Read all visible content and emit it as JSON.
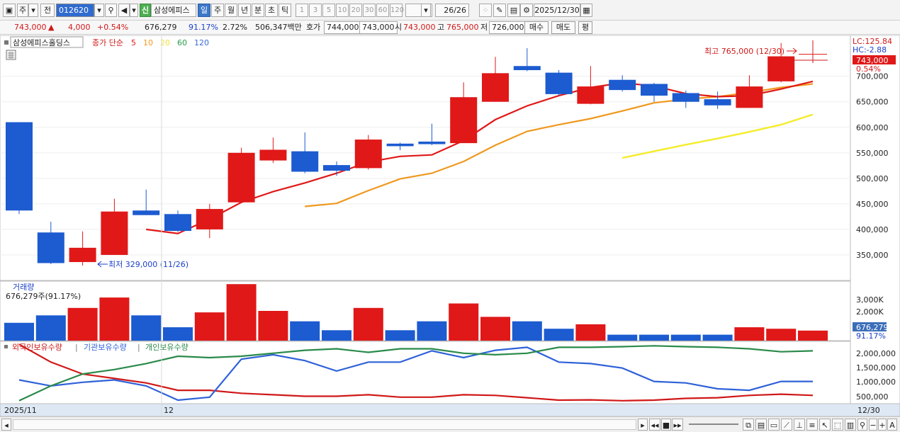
{
  "toolbar": {
    "period_label": "주",
    "prev_label": "전",
    "stock_code": "012620",
    "new_badge": "신",
    "stock_name": "삼성에피스",
    "periods": [
      "일",
      "주",
      "월",
      "년",
      "분",
      "초",
      "틱"
    ],
    "active_period": "일",
    "intervals": [
      "1",
      "3",
      "5",
      "10",
      "20",
      "30",
      "60",
      "120"
    ],
    "count_display": "26/26",
    "date": "2025/12/30"
  },
  "info": {
    "price": "743,000",
    "change_arrow": "▲",
    "change": "4,000",
    "change_pct": "+0.54%",
    "volume": "676,279",
    "turnover_pct": "91.17%",
    "ratio_pct": "2.72%",
    "amount": "506,347백만",
    "quote_label": "호가",
    "quote_ask": "744,000",
    "quote_bid": "743,000",
    "open_label": "시",
    "open": "743,000",
    "high_label": "고",
    "high": "765,000",
    "low_label": "저",
    "low": "726,000",
    "buy_label": "매수",
    "sell_label": "매도",
    "avg_label": "평"
  },
  "legend": {
    "name": "삼성에피스홀딩스",
    "indicator": "종가 단순",
    "mas": [
      {
        "period": "5",
        "color": "#e01818"
      },
      {
        "period": "10",
        "color": "#f09820"
      },
      {
        "period": "20",
        "color": "#f0e040"
      },
      {
        "period": "60",
        "color": "#2a9a4a"
      },
      {
        "period": "120",
        "color": "#3a6ad8"
      }
    ]
  },
  "annotations": {
    "high": "최고 765,000 (12/30)",
    "low": "최저 329,000 (11/26)"
  },
  "right_axis": {
    "lc": "LC:125.84",
    "hc": "HC:-2.88",
    "last_price_tag": "743,000",
    "last_pct": "0.54%",
    "price_ticks": [
      "700,000",
      "650,000",
      "600,000",
      "550,000",
      "500,000",
      "450,000",
      "400,000",
      "350,000"
    ],
    "volume_ticks": [
      "3,000K",
      "2,000K"
    ],
    "volume_tag": "676,279",
    "volume_pct": "91.17%",
    "holding_ticks": [
      "2,000,000",
      "1,500,000",
      "1,000,000",
      "500,000"
    ]
  },
  "volume_panel": {
    "title": "거래량",
    "value": "676,279주(91.17%)"
  },
  "holding_panel": {
    "series": [
      {
        "name": "외국인보유수량",
        "color": "#d01818"
      },
      {
        "name": "기관보유수량",
        "color": "#2f62d8"
      },
      {
        "name": "개인보유수량",
        "color": "#2a8a4a"
      }
    ]
  },
  "x_axis": {
    "labels": [
      "2025/11",
      "12"
    ],
    "end_label": "12/30"
  },
  "chart_data": [
    {
      "type": "candlestick",
      "name": "삼성에피스홀딩스",
      "ylim": [
        300000,
        780000
      ],
      "candles": [
        {
          "o": 610000,
          "h": 610000,
          "l": 430000,
          "c": 437000
        },
        {
          "o": 394000,
          "h": 415000,
          "l": 332000,
          "c": 334000
        },
        {
          "o": 336000,
          "h": 396000,
          "l": 329000,
          "c": 364000
        },
        {
          "o": 350000,
          "h": 460000,
          "l": 350000,
          "c": 435000
        },
        {
          "o": 437000,
          "h": 478000,
          "l": 428000,
          "c": 428000
        },
        {
          "o": 430000,
          "h": 437000,
          "l": 395000,
          "c": 397000
        },
        {
          "o": 400000,
          "h": 450000,
          "l": 383000,
          "c": 440000
        },
        {
          "o": 453000,
          "h": 560000,
          "l": 453000,
          "c": 550000
        },
        {
          "o": 535000,
          "h": 580000,
          "l": 530000,
          "c": 556000
        },
        {
          "o": 553000,
          "h": 590000,
          "l": 510000,
          "c": 513000
        },
        {
          "o": 526000,
          "h": 533000,
          "l": 505000,
          "c": 515000
        },
        {
          "o": 520000,
          "h": 585000,
          "l": 517000,
          "c": 576000
        },
        {
          "o": 568000,
          "h": 570000,
          "l": 555000,
          "c": 563000
        },
        {
          "o": 572000,
          "h": 607000,
          "l": 565000,
          "c": 567000
        },
        {
          "o": 569000,
          "h": 688000,
          "l": 569000,
          "c": 659000
        },
        {
          "o": 650000,
          "h": 738000,
          "l": 650000,
          "c": 706000
        },
        {
          "o": 720000,
          "h": 755000,
          "l": 710000,
          "c": 712000
        },
        {
          "o": 707000,
          "h": 712000,
          "l": 662000,
          "c": 665000
        },
        {
          "o": 646000,
          "h": 720000,
          "l": 645000,
          "c": 680000
        },
        {
          "o": 693000,
          "h": 702000,
          "l": 670000,
          "c": 673000
        },
        {
          "o": 685000,
          "h": 687000,
          "l": 650000,
          "c": 662000
        },
        {
          "o": 667000,
          "h": 672000,
          "l": 638000,
          "c": 650000
        },
        {
          "o": 655000,
          "h": 670000,
          "l": 636000,
          "c": 643000
        },
        {
          "o": 638000,
          "h": 702000,
          "l": 638000,
          "c": 680000
        },
        {
          "o": 690000,
          "h": 765000,
          "l": 688000,
          "c": 739000
        },
        {
          "o": 743000,
          "h": 765000,
          "l": 726000,
          "c": 743000
        }
      ],
      "ma5": [
        null,
        null,
        null,
        null,
        400000,
        392000,
        420000,
        453000,
        474000,
        491000,
        510000,
        532000,
        543000,
        546000,
        574000,
        615000,
        642000,
        662000,
        678000,
        687000,
        681000,
        666000,
        660000,
        662000,
        675000,
        690000
      ],
      "ma10": [
        null,
        null,
        null,
        null,
        null,
        null,
        null,
        null,
        null,
        445000,
        451000,
        476000,
        499000,
        510000,
        533000,
        565000,
        592000,
        605000,
        617000,
        632000,
        648000,
        655000,
        660000,
        668000,
        678000,
        685000
      ],
      "ma20": [
        null,
        null,
        null,
        null,
        null,
        null,
        null,
        null,
        null,
        null,
        null,
        null,
        null,
        null,
        null,
        null,
        null,
        null,
        null,
        540000,
        553000,
        566000,
        578000,
        591000,
        605000,
        625000
      ]
    },
    {
      "type": "bar",
      "name": "거래량",
      "ylim": [
        0,
        4000000
      ],
      "values": [
        1200000,
        1700000,
        2200000,
        2900000,
        1700000,
        900000,
        1900000,
        3800000,
        2000000,
        1300000,
        700000,
        2200000,
        700000,
        1300000,
        2500000,
        1600000,
        1300000,
        800000,
        1100000,
        400000,
        400000,
        400000,
        400000,
        900000,
        800000,
        676279
      ],
      "up": [
        false,
        false,
        true,
        true,
        false,
        false,
        true,
        true,
        true,
        false,
        false,
        true,
        false,
        false,
        true,
        true,
        false,
        false,
        true,
        false,
        false,
        false,
        false,
        true,
        true,
        true
      ]
    },
    {
      "type": "line",
      "name": "보유수량",
      "ylim": [
        200000,
        2300000
      ],
      "series": [
        {
          "name": "외국인보유수량",
          "values": [
            2200000,
            1600000,
            1200000,
            1050000,
            900000,
            650000,
            650000,
            550000,
            500000,
            450000,
            450000,
            500000,
            420000,
            420000,
            500000,
            480000,
            400000,
            320000,
            330000,
            300000,
            320000,
            380000,
            400000,
            480000,
            520000,
            480000
          ]
        },
        {
          "name": "기관보유수량",
          "values": [
            1000000,
            800000,
            920000,
            1000000,
            800000,
            320000,
            420000,
            1700000,
            1850000,
            1650000,
            1300000,
            1600000,
            1600000,
            1980000,
            1750000,
            2000000,
            2100000,
            1600000,
            1550000,
            1400000,
            950000,
            900000,
            700000,
            650000,
            950000,
            950000
          ]
        },
        {
          "name": "개인보유수량",
          "values": [
            300000,
            800000,
            1200000,
            1350000,
            1550000,
            1800000,
            1750000,
            1800000,
            1900000,
            2000000,
            2050000,
            1930000,
            2050000,
            2050000,
            1900000,
            1850000,
            1900000,
            2100000,
            2100000,
            2120000,
            2150000,
            2120000,
            2100000,
            2050000,
            1950000,
            1980000
          ]
        }
      ]
    }
  ]
}
